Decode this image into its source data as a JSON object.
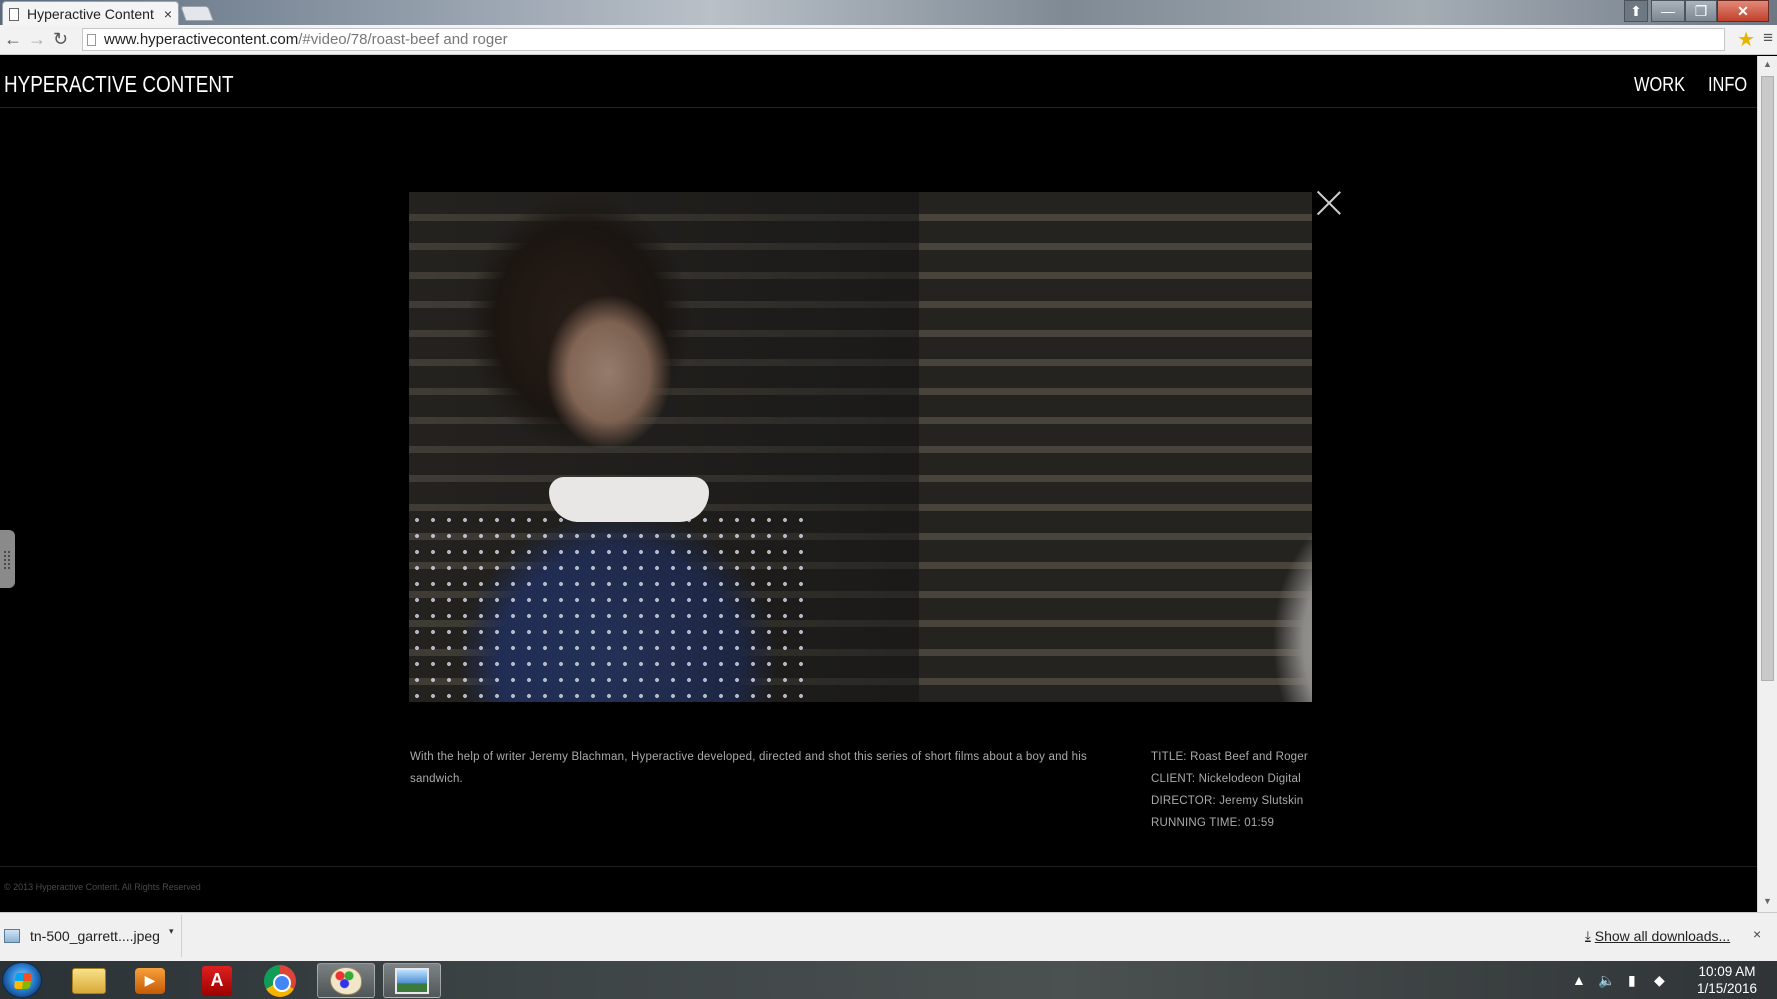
{
  "browser": {
    "tab_title": "Hyperactive Content",
    "tab_close": "×",
    "url_host": "www.hyperactivecontent.com",
    "url_path": "/#video/78/roast-beef and roger",
    "back": "←",
    "forward": "→",
    "reload": "↻",
    "star": "★",
    "menu": "≡",
    "win_profile": "⬆",
    "win_min": "—",
    "win_max": "❐",
    "win_close": "✕"
  },
  "site": {
    "logo": "HYPERACTIVE CONTENT",
    "nav": [
      "WORK",
      "INFO"
    ],
    "video_alt": "Still frame of a girl in a blue polka-dot dress",
    "description": "With the help of writer Jeremy Blachman, Hyperactive developed, directed and shot this series of short films about a boy and his sandwich.",
    "meta": {
      "title": "TITLE: Roast Beef and Roger",
      "client": "CLIENT: Nickelodeon Digital",
      "director": "DIRECTOR: Jeremy Slutskin",
      "running_time": "RUNNING TIME: 01:59"
    },
    "footer": "© 2013 Hyperactive Content. All Rights Reserved"
  },
  "downloads": {
    "file_name": "tn-500_garrett....jpeg",
    "caret": "▾",
    "show_all": "Show all downloads...",
    "arrow": "⤓",
    "close": "×"
  },
  "taskbar": {
    "apps": [
      "windows-explorer",
      "media-player",
      "adobe-acrobat",
      "google-chrome",
      "paint",
      "photo-viewer"
    ],
    "active_app": "photo-viewer",
    "tray_up": "▲",
    "time": "10:09 AM",
    "date": "1/15/2016"
  }
}
